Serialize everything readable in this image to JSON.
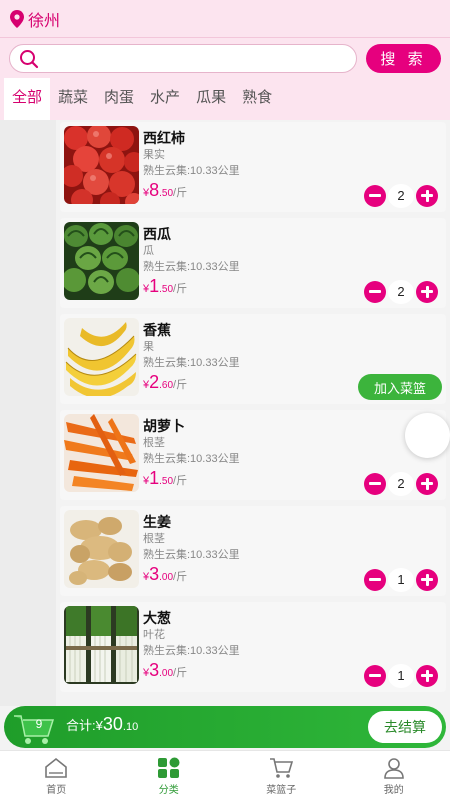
{
  "header": {
    "city": "徐州"
  },
  "search": {
    "placeholder": "",
    "button_label": "搜 索"
  },
  "tabs": [
    "全部",
    "蔬菜",
    "肉蛋",
    "水产",
    "瓜果",
    "熟食"
  ],
  "products": [
    {
      "name": "西红柿",
      "category": "果实",
      "store": "熟生云集:10.33公里",
      "price_currency": "¥",
      "price_int": "8",
      "price_dec": ".50",
      "unit": "/斤",
      "qty": "2",
      "image": "tomato"
    },
    {
      "name": "西瓜",
      "category": "瓜",
      "store": "熟生云集:10.33公里",
      "price_currency": "¥",
      "price_int": "1",
      "price_dec": ".50",
      "unit": "/斤",
      "qty": "2",
      "image": "watermelon"
    },
    {
      "name": "香蕉",
      "category": "果",
      "store": "熟生云集:10.33公里",
      "price_currency": "¥",
      "price_int": "2",
      "price_dec": ".60",
      "unit": "/斤",
      "qty": "",
      "add_label": "加入菜篮",
      "image": "banana"
    },
    {
      "name": "胡萝卜",
      "category": "根茎",
      "store": "熟生云集:10.33公里",
      "price_currency": "¥",
      "price_int": "1",
      "price_dec": ".50",
      "unit": "/斤",
      "qty": "2",
      "image": "carrot"
    },
    {
      "name": "生姜",
      "category": "根茎",
      "store": "熟生云集:10.33公里",
      "price_currency": "¥",
      "price_int": "3",
      "price_dec": ".00",
      "unit": "/斤",
      "qty": "1",
      "image": "ginger"
    },
    {
      "name": "大葱",
      "category": "叶花",
      "store": "熟生云集:10.33公里",
      "price_currency": "¥",
      "price_int": "3",
      "price_dec": ".00",
      "unit": "/斤",
      "qty": "1",
      "image": "scallion"
    }
  ],
  "cart": {
    "count": "9",
    "total_label": "合计:",
    "currency": "¥",
    "total_int": "30",
    "total_dec": ".10",
    "checkout_label": "去结算"
  },
  "nav": [
    {
      "label": "首页",
      "icon": "home-icon"
    },
    {
      "label": "分类",
      "icon": "category-icon"
    },
    {
      "label": "菜篮子",
      "icon": "cart-icon"
    },
    {
      "label": "我的",
      "icon": "profile-icon"
    }
  ],
  "colors": {
    "accent": "#e6007e",
    "header_bg": "#fce4ef",
    "green": "#2fb73a"
  }
}
